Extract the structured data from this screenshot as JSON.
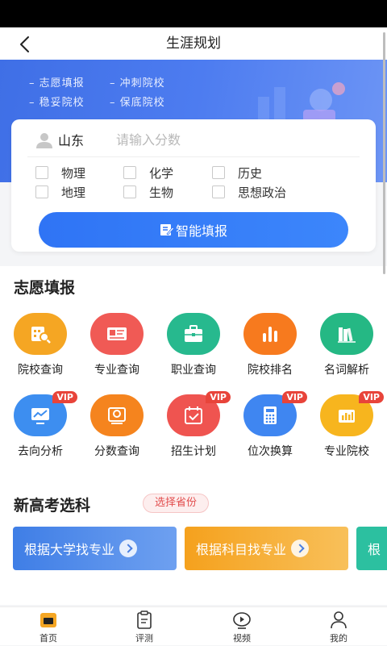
{
  "header": {
    "title": "生涯规划"
  },
  "banner": {
    "slogans": [
      "– 志愿填报",
      "– 冲刺院校",
      "– 稳妥院校",
      "– 保底院校"
    ]
  },
  "form": {
    "province": "山东",
    "score_placeholder": "请输入分数",
    "subjects": [
      "物理",
      "化学",
      "历史",
      "地理",
      "生物",
      "思想政治"
    ],
    "submit_label": "智能填报"
  },
  "section1": {
    "title": "志愿填报",
    "features": [
      {
        "label": "院校查询",
        "icon": "school-icon",
        "color": "#f5a623",
        "vip": false
      },
      {
        "label": "专业查询",
        "icon": "major-card-icon",
        "color": "#f05a55",
        "vip": false
      },
      {
        "label": "职业查询",
        "icon": "briefcase-icon",
        "color": "#27b98e",
        "vip": false
      },
      {
        "label": "院校排名",
        "icon": "bar-chart-icon",
        "color": "#f77a1e",
        "vip": false
      },
      {
        "label": "名词解析",
        "icon": "books-icon",
        "color": "#25b884",
        "vip": false
      },
      {
        "label": "去向分析",
        "icon": "trend-monitor-icon",
        "color": "#3d8ef0",
        "vip": true
      },
      {
        "label": "分数查询",
        "icon": "score-search-icon",
        "color": "#f5841e",
        "vip": false
      },
      {
        "label": "招生计划",
        "icon": "calendar-check-icon",
        "color": "#ef5450",
        "vip": true
      },
      {
        "label": "位次换算",
        "icon": "calculator-icon",
        "color": "#3f86f1",
        "vip": true
      },
      {
        "label": "专业院校",
        "icon": "column-chart-icon",
        "color": "#f7b51e",
        "vip": true
      }
    ],
    "vip_label": "VIP"
  },
  "section2": {
    "title": "新高考选科",
    "pill_label": "选择省份",
    "cards": [
      {
        "label": "根据大学找专业",
        "color": "#4a86e8"
      },
      {
        "label": "根据科目找专业",
        "color": "#f5a623"
      },
      {
        "label": "根",
        "color": "#2cc0a0"
      }
    ]
  },
  "tabs": [
    {
      "label": "首页",
      "icon": "home-icon",
      "active": true
    },
    {
      "label": "评测",
      "icon": "clipboard-icon",
      "active": false
    },
    {
      "label": "视频",
      "icon": "video-play-icon",
      "active": false
    },
    {
      "label": "我的",
      "icon": "user-icon",
      "active": false
    }
  ],
  "colors": {
    "banner": "#4d7cf0",
    "primary_button": "#2f74f5",
    "vip_badge": "#e8443a"
  }
}
